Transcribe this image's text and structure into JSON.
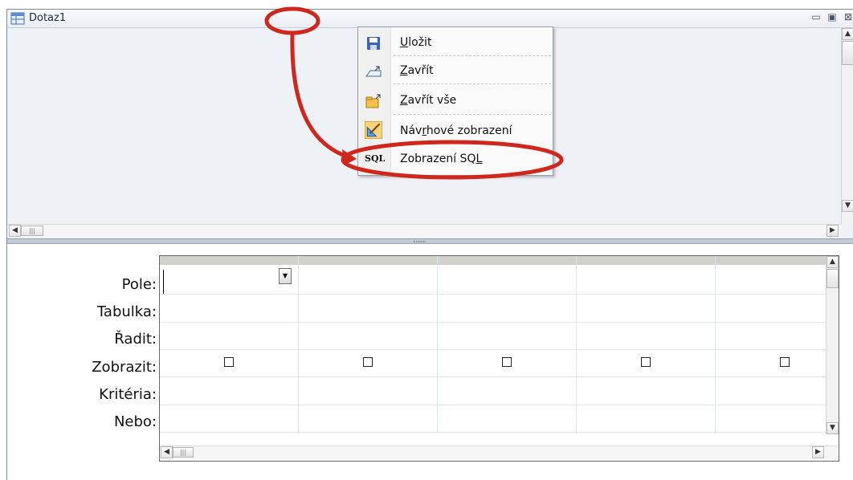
{
  "window": {
    "title": "Dotaz1",
    "controls": {
      "minimize": "▭",
      "maximize": "▣",
      "close": "⊠"
    }
  },
  "context_menu": {
    "items": [
      {
        "label": "Uložit",
        "icon": "save-icon"
      },
      {
        "label": "Zavřít",
        "icon": "close-window-icon"
      },
      {
        "label": "Zavřít vše",
        "icon": "close-all-icon"
      },
      {
        "label": "Návrhové zobrazení",
        "icon": "design-view-icon"
      },
      {
        "label": "Zobrazení SQL",
        "icon": "sql-view-icon",
        "icon_text": "SQL"
      }
    ]
  },
  "design_grid": {
    "row_labels": [
      "Pole:",
      "Tabulka:",
      "Řadit:",
      "Zobrazit:",
      "Kritéria:",
      "Nebo:"
    ],
    "column_count": 5,
    "show_checked": [
      false,
      false,
      false,
      false,
      false
    ]
  },
  "annotation": {
    "color": "#d0271d",
    "shape": "red ellipses with arrow"
  },
  "scroll": {
    "thumb_glyph": "|||",
    "left_arrow": "◀",
    "right_arrow": "▶",
    "up_arrow": "▲",
    "down_arrow": "▼",
    "grip": "··········"
  }
}
